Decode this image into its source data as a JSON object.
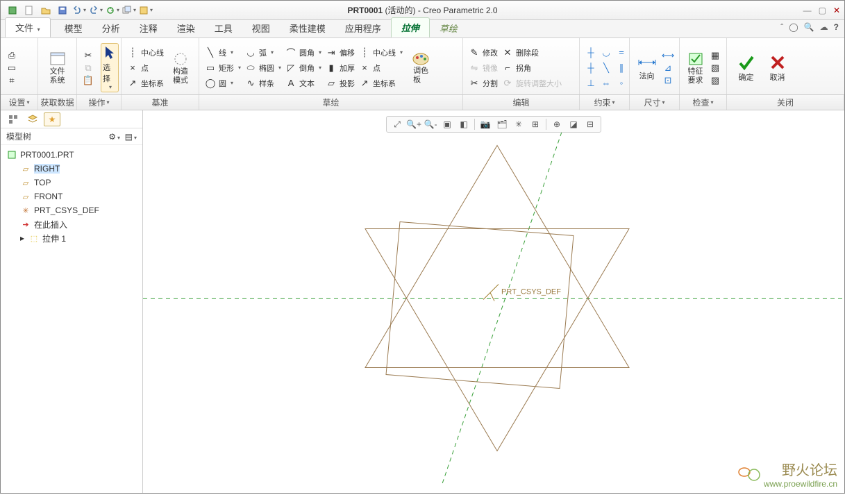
{
  "app": {
    "doc_name": "PRT0001",
    "doc_state": "(活动的)",
    "product": "Creo Parametric 2.0",
    "title_sep": " - "
  },
  "tabs": {
    "file": "文件",
    "items": [
      "模型",
      "分析",
      "注释",
      "渲染",
      "工具",
      "视图",
      "柔性建模",
      "应用程序"
    ],
    "contextual": [
      "拉伸",
      "草绘"
    ],
    "active_contextual": 0
  },
  "ribbon": {
    "g_settings": {
      "label": "设置",
      "data_label": "获取数据"
    },
    "g_ops": {
      "label": "操作",
      "big": "文件\n系统",
      "select": "选择"
    },
    "g_datum": {
      "label": "基准",
      "centerline": "中心线",
      "point": "点",
      "csys": "坐标系",
      "construct": "构造\n模式"
    },
    "g_sketch": {
      "label": "草绘",
      "line": "线",
      "rect": "矩形",
      "circle": "圆",
      "arc": "弧",
      "ellipse": "椭圆",
      "spline": "样条",
      "fillet": "圆角",
      "chamfer": "倒角",
      "text": "文本",
      "offset": "偏移",
      "thicken": "加厚",
      "project": "投影",
      "centerline": "中心线",
      "point": "点",
      "csys": "坐标系",
      "palette": "调色\n板"
    },
    "g_edit": {
      "label": "编辑",
      "modify": "修改",
      "delete_seg": "删除段",
      "mirror": "镜像",
      "corner": "拐角",
      "divide": "分割",
      "rotate": "旋转调整大小"
    },
    "g_constrain": {
      "label": "约束"
    },
    "g_dim": {
      "label": "尺寸",
      "normal": "法向"
    },
    "g_inspect": {
      "label": "检查",
      "feature": "特征\n要求"
    },
    "g_close": {
      "label": "关闭",
      "ok": "确定",
      "cancel": "取消"
    }
  },
  "tree": {
    "header": "模型树",
    "root": "PRT0001.PRT",
    "nodes": [
      {
        "label": "RIGHT",
        "icon": "plane",
        "selected": true
      },
      {
        "label": "TOP",
        "icon": "plane"
      },
      {
        "label": "FRONT",
        "icon": "plane"
      },
      {
        "label": "PRT_CSYS_DEF",
        "icon": "csys"
      },
      {
        "label": "在此插入",
        "icon": "arrow"
      },
      {
        "label": "拉伸 1",
        "icon": "extrude"
      }
    ]
  },
  "canvas": {
    "csys_label": "PRT_CSYS_DEF"
  },
  "watermark": {
    "cn": "野火论坛",
    "url": "www.proewildfire.cn"
  }
}
